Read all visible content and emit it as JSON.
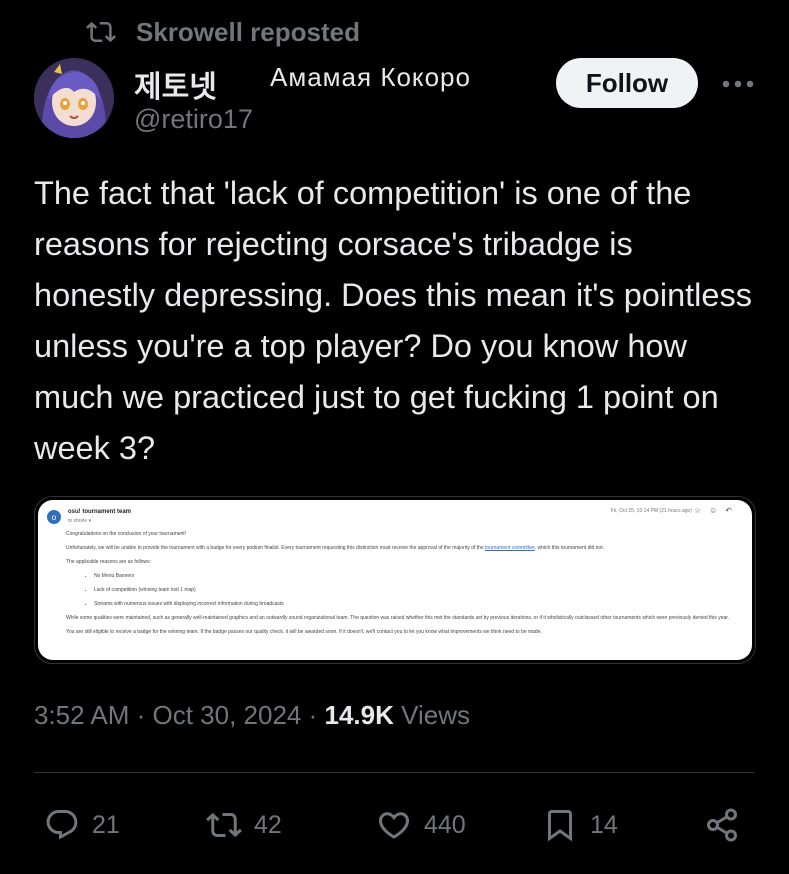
{
  "repost": {
    "icon": "repost-icon",
    "text": "Skrowell reposted"
  },
  "author": {
    "display_name": "제토넷",
    "alt_name": "Амамая Кокоро",
    "handle": "@retiro17",
    "avatar_icon": "anime-avatar"
  },
  "follow_label": "Follow",
  "more_icon": "more-icon",
  "tweet_text": "The fact that 'lack of competition' is one of the reasons for rejecting corsace's tribadge is honestly depressing. Does this mean it's pointless unless you're a top player? Do you know how much we practiced just to get fucking 1 point on week 3?",
  "media": {
    "sender": "osu! tournament team",
    "to": "to shrele ▾",
    "date": "Fri, Oct 25, 10:14 PM (21 hours ago)",
    "greeting": "Congratulations on the conclusion of your tournament!",
    "para1_a": "Unfortunately, we will be unable to provide the tournament with a badge for every podium finalist. Every tournament requesting this distinction must receive the approval of the majority of the",
    "para1_link": "tournament committee",
    "para1_b": ", which this tournament did not.",
    "reasons_intro": "The applicable reasons are as follows:",
    "reasons": [
      "No Menu Banners",
      "Lack of competition (winning team lost 1 map)",
      "Streams with numerous issues with displaying incorrect information during broadcasts"
    ],
    "para2": "While some qualities were maintained, such as generally well-maintained graphics and an outwardly sound organizational team. The question was raised whether this met the standards set by previous iterations, or if it wholistically outclassed other tournaments which were previously denied this year.",
    "para3": "You are still eligible to receive a badge for the winning team. If the badge passes our quality check, it will be awarded soon. If it doesn't, we'll contact you to let you know what improvements we think need to be made."
  },
  "meta": {
    "time": "3:52 AM",
    "sep1": " · ",
    "date": "Oct 30, 2024",
    "sep2": " · ",
    "views_count": "14.9K",
    "views_label": " Views"
  },
  "actions": {
    "replies": "21",
    "reposts": "42",
    "likes": "440",
    "bookmarks": "14"
  },
  "colors": {
    "background": "#000000",
    "text": "#e7e9ea",
    "muted": "#71767b",
    "button_bg": "#eff3f4"
  }
}
